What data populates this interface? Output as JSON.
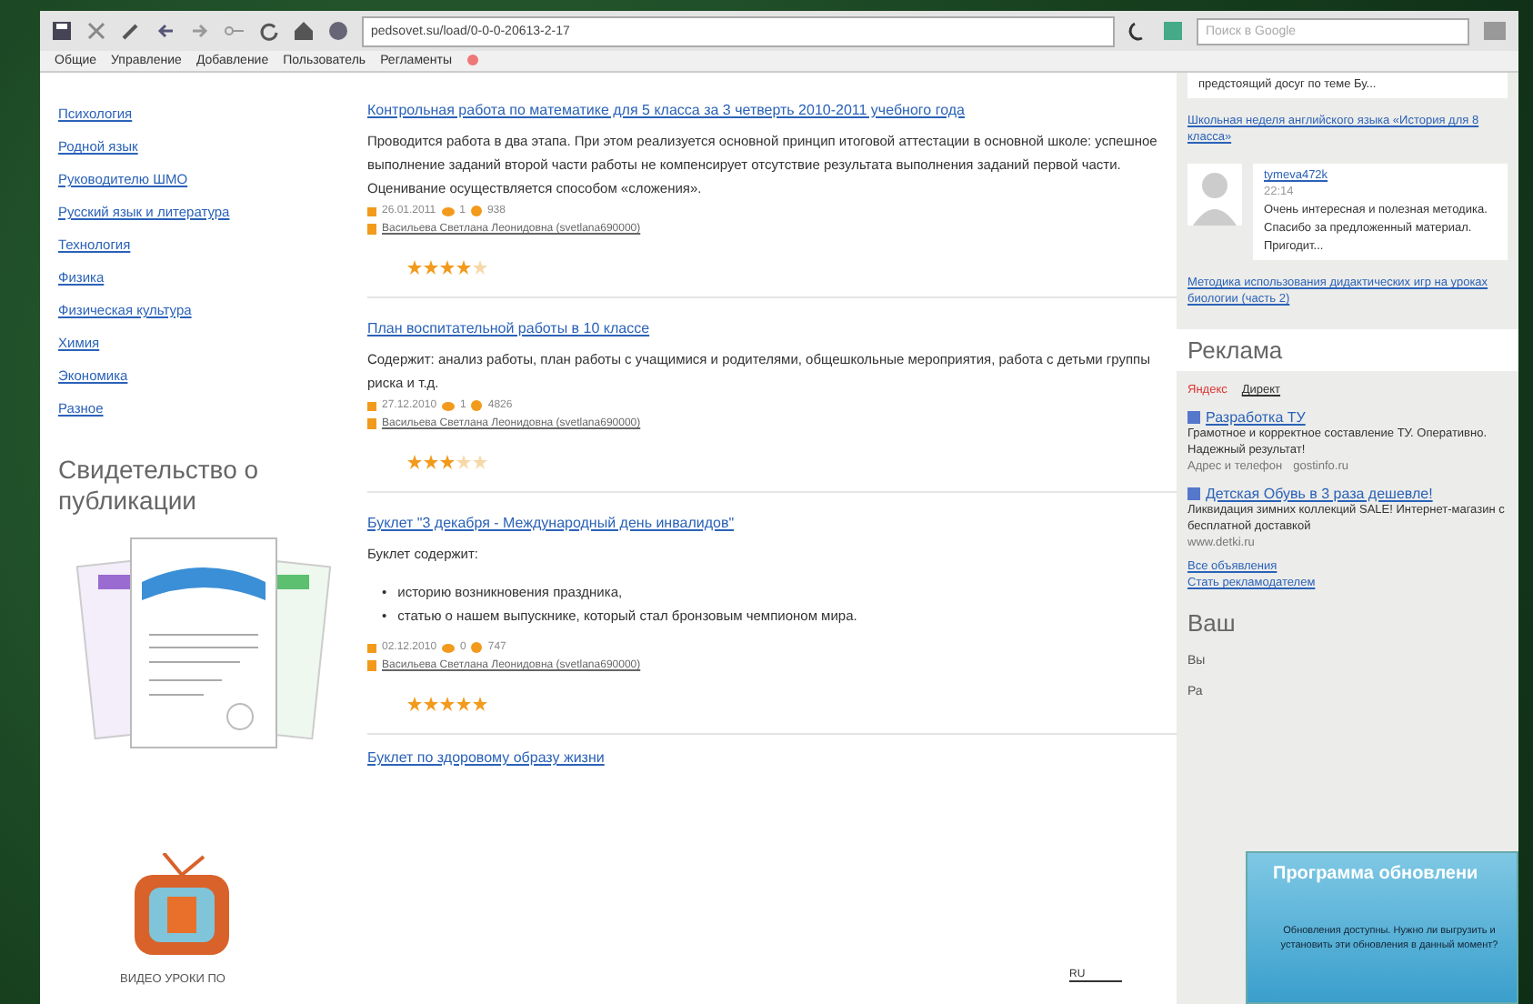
{
  "toolbar": {
    "address": "pedsovet.su/load/0-0-0-20613-2-17",
    "search": {
      "placeholder": "Поиск в Google"
    }
  },
  "menu": [
    "Общие",
    "Управление",
    "Добавление",
    "Пользователь",
    "Регламенты"
  ],
  "sidebar": {
    "links": [
      "Психология",
      "Родной язык",
      "Руководителю ШМО",
      "Русский язык и литература",
      "Технология",
      "Физика",
      "Физическая культура",
      "Химия",
      "Экономика",
      "Разное"
    ],
    "certificate_title": "Свидетельство о публикации",
    "video_caption": "ВИДЕО УРОКИ ПО"
  },
  "articles": [
    {
      "title": "Контрольная работа по математике для 5 класса за 3 четверть 2010-2011 учебного года",
      "kind": "text",
      "text": "Проводится работа в два этапа. При этом реализуется основной принцип итоговой аттестации в основной школе: успешное выполнение заданий второй части работы не компенсирует отсутствие результата выполнения заданий первой части. Оценивание осуществляется способом «сложения».",
      "date": "26.01.2011",
      "comments": "1",
      "views": "938",
      "author": "Васильева Светлана Леонидовна (svetlana690000)",
      "stars": 4
    },
    {
      "title": "План воспитательной работы в 10 классе",
      "kind": "text",
      "text": "Содержит: анализ работы, план работы с учащимися и родителями, общешкольные мероприятия, работа с детьми группы риска и т.д.",
      "date": "27.12.2010",
      "comments": "1",
      "views": "4826",
      "author": "Васильева Светлана Леонидовна (svetlana690000)",
      "stars": 3
    },
    {
      "title": "Буклет \"3 декабря - Международный день инвалидов\"",
      "kind": "list",
      "text": "Буклет содержит:",
      "marker": "•",
      "items": [
        "историю возникновения праздника,",
        "статью о нашем выпускнике, который стал бронзовым чемпионом мира."
      ],
      "date": "02.12.2010",
      "comments": "0",
      "views": "747",
      "author": "Васильева Светлана Леонидовна (svetlana690000)",
      "stars": 5
    },
    {
      "title": "Буклет по здоровому образу жизни",
      "kind": "cut"
    }
  ],
  "language": "RU",
  "comments": {
    "snippet": "предстоящий досуг по теме Бу...",
    "link_1": "Школьная неделя английского языка «История для 8 класса»",
    "user": "tymeva472k",
    "time": "22:14",
    "text": "Очень интересная и полезная методика. Спасибо за предложенный материал. Пригодит...",
    "link_2": "Методика использования дидактических игр на уроках биологии (часть 2)"
  },
  "ads": {
    "title": "Реклама",
    "source_1": "Яндекс",
    "source_2": "Директ",
    "items": [
      {
        "title": "Разработка ТУ",
        "text": "Грамотное и корректное составление ТУ. Оперативно. Надежный результат!",
        "contact": "Адрес и телефон",
        "site": "gostinfo.ru"
      },
      {
        "title": "Детская Обувь в 3 раза дешевле!",
        "text": "Ликвидация зимних коллекций SALE! Интернет-магазин с бесплатной доставкой",
        "site": "www.detki.ru"
      }
    ],
    "all": "Все объявления",
    "become": "Стать рекламодателем"
  },
  "cut_heading": "Ваш",
  "cut_lines": [
    "Вы",
    "Ра"
  ],
  "popup": {
    "title": "Программа обновлени",
    "text": "Обновления доступны. Нужно ли выгрузить и установить эти обновления в данный момент?"
  }
}
